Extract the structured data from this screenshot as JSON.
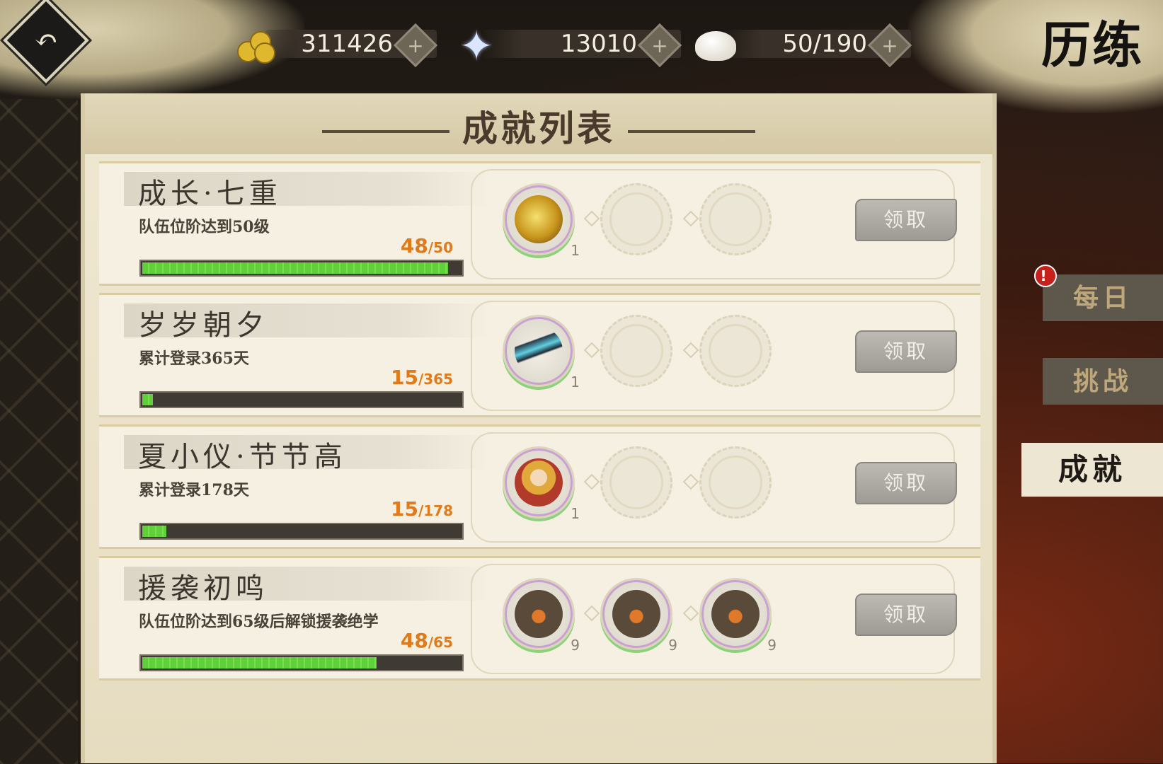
{
  "header": {
    "page_title": "历练",
    "back_icon": "back-arrow-icon",
    "resources": [
      {
        "icon": "coin-icon",
        "value": "311426"
      },
      {
        "icon": "star-crystal-icon",
        "value": "13010"
      },
      {
        "icon": "steamed-bun-icon",
        "value": "50/190"
      }
    ]
  },
  "panel": {
    "title": "成就列表"
  },
  "achievements": [
    {
      "name": "成长·七重",
      "desc": "队伍位阶达到50级",
      "current": "48",
      "total": "/50",
      "progress": 0.96,
      "rewards": [
        {
          "icon": "gold-compass-icon",
          "qty": "1"
        }
      ],
      "claim_label": "领取"
    },
    {
      "name": "岁岁朝夕",
      "desc": "累计登录365天",
      "current": "15",
      "total": "/365",
      "progress": 0.041,
      "rewards": [
        {
          "icon": "sword-icon",
          "qty": "1"
        }
      ],
      "claim_label": "领取"
    },
    {
      "name": "夏小仪·节节高",
      "desc": "累计登录178天",
      "current": "15",
      "total": "/178",
      "progress": 0.084,
      "rewards": [
        {
          "icon": "character-portrait-icon",
          "qty": "1"
        }
      ],
      "claim_label": "领取"
    },
    {
      "name": "援袭初鸣",
      "desc": "队伍位阶达到65级后解锁援袭绝学",
      "current": "48",
      "total": "/65",
      "progress": 0.738,
      "rewards": [
        {
          "icon": "skill-token-icon",
          "qty": "9"
        },
        {
          "icon": "skill-token-icon",
          "qty": "9"
        },
        {
          "icon": "skill-token-icon",
          "qty": "9"
        }
      ],
      "claim_label": "领取"
    }
  ],
  "side_tabs": [
    {
      "label": "每日",
      "badge": "!",
      "active": false
    },
    {
      "label": "挑战",
      "active": false
    },
    {
      "label": "成就",
      "active": true
    }
  ],
  "colors": {
    "progress_fill": "#5fd03a",
    "progress_text": "#e07a1a",
    "badge": "#c8201a"
  }
}
